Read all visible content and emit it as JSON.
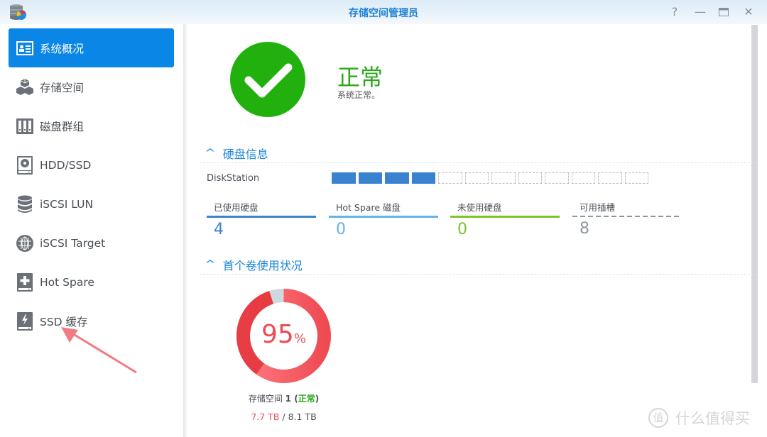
{
  "window": {
    "title": "存储空间管理员",
    "app_icon": "storage-manager-icon",
    "buttons": {
      "help": "?",
      "minimize": "—",
      "maximize": "▭",
      "close": "✕"
    }
  },
  "sidebar": {
    "items": [
      {
        "label": "系统概况",
        "icon": "overview-icon",
        "active": true
      },
      {
        "label": "存储空间",
        "icon": "cubes-icon",
        "active": false
      },
      {
        "label": "磁盘群组",
        "icon": "disk-group-icon",
        "active": false
      },
      {
        "label": "HDD/SSD",
        "icon": "hdd-icon",
        "active": false
      },
      {
        "label": "iSCSI LUN",
        "icon": "database-icon",
        "active": false
      },
      {
        "label": "iSCSI Target",
        "icon": "globe-icon",
        "active": false
      },
      {
        "label": "Hot Spare",
        "icon": "hot-spare-icon",
        "active": false
      },
      {
        "label": "SSD 缓存",
        "icon": "ssd-cache-icon",
        "active": false
      }
    ]
  },
  "status": {
    "title": "正常",
    "description": "系统正常。",
    "color": "#22b00f"
  },
  "disk_info": {
    "section_title": "硬盘信息",
    "device_name": "DiskStation",
    "total_slots": 12,
    "used_slots": 4,
    "stats": [
      {
        "label": "已使用硬盘",
        "value": "4",
        "color": "#3a82cf",
        "style": "solid"
      },
      {
        "label": "Hot Spare 磁盘",
        "value": "0",
        "color": "#5fb4ee",
        "style": "solid"
      },
      {
        "label": "未使用硬盘",
        "value": "0",
        "color": "#7cc42a",
        "style": "solid"
      },
      {
        "label": "可用插槽",
        "value": "8",
        "color": "#8e969e",
        "style": "dashed"
      }
    ]
  },
  "volume_usage": {
    "section_title": "首个卷使用状况",
    "percent": 95,
    "percent_text": "95",
    "percent_sign": "%",
    "volume_name": "存储空间",
    "volume_number": "1",
    "volume_status_open": " (",
    "volume_status": "正常",
    "volume_status_close": ")",
    "used": "7.7 TB",
    "separator": " / ",
    "total": "8.1 TB",
    "colors": {
      "used": "#ef4b53",
      "free": "#cfd8e0"
    }
  },
  "watermark": {
    "badge": "值",
    "text": "什么值得买"
  }
}
